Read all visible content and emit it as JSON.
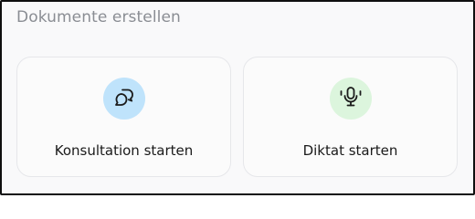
{
  "section": {
    "title": "Dokumente erstellen"
  },
  "cards": [
    {
      "label": "Konsultation starten",
      "icon": "chat-bubbles-icon",
      "color": "#bfe3fb"
    },
    {
      "label": "Diktat starten",
      "icon": "microphone-icon",
      "color": "#dcf5dd"
    }
  ]
}
